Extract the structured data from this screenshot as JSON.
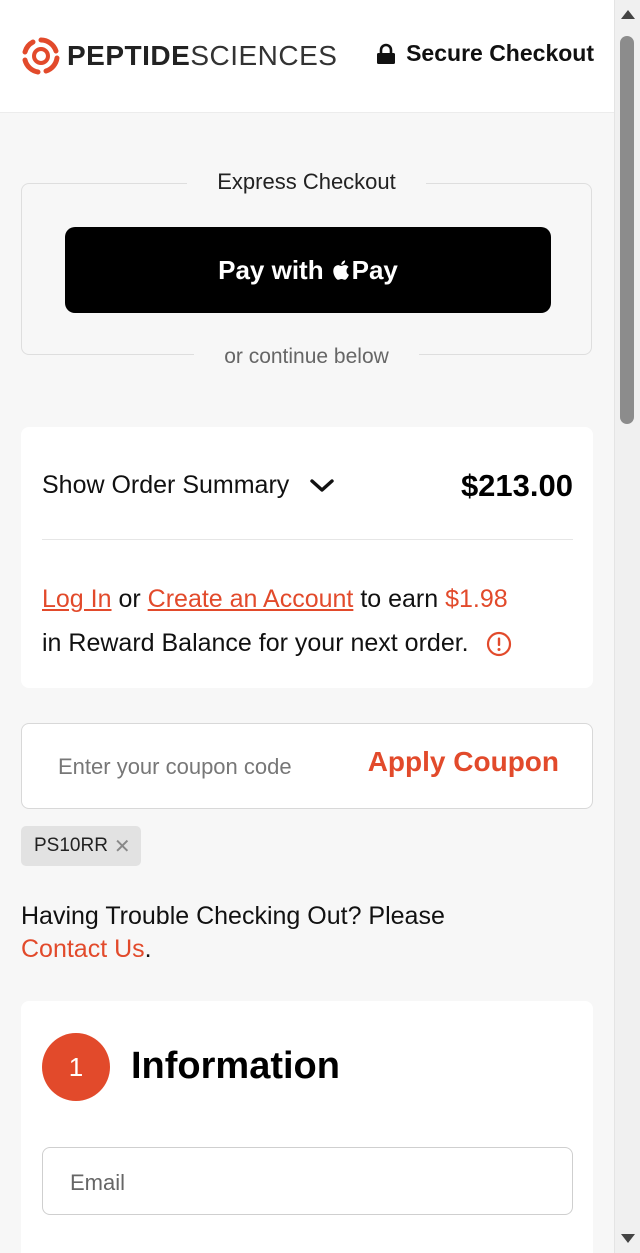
{
  "header": {
    "brand_bold": "PEPTIDE",
    "brand_light": "SCIENCES",
    "secure_label": "Secure Checkout"
  },
  "express": {
    "title": "Express Checkout",
    "apple_pay_prefix": "Pay with",
    "apple_pay_suffix": "Pay",
    "continue_label": "or continue below"
  },
  "summary": {
    "toggle_label": "Show Order Summary",
    "total": "$213.00",
    "reward": {
      "login": "Log In",
      "or": "or",
      "create": "Create an Account",
      "to_earn": "to earn",
      "amount": "$1.98",
      "rest": "in Reward Balance for your next order."
    }
  },
  "coupon": {
    "placeholder": "Enter your coupon code",
    "apply_label": "Apply Coupon",
    "applied_code": "PS10RR",
    "remove_glyph": "✕"
  },
  "help": {
    "text": "Having Trouble Checking Out? Please",
    "link": "Contact Us",
    "end": "."
  },
  "information": {
    "step": "1",
    "title": "Information",
    "email_placeholder": "Email"
  },
  "colors": {
    "accent": "#e24a2b",
    "page_bg": "#f7f7f7",
    "apple_pay_bg": "#000000"
  },
  "icons": [
    "peptide-sciences-logo-icon",
    "lock-icon",
    "apple-icon",
    "chevron-down-icon",
    "info-circle-icon",
    "close-icon"
  ]
}
